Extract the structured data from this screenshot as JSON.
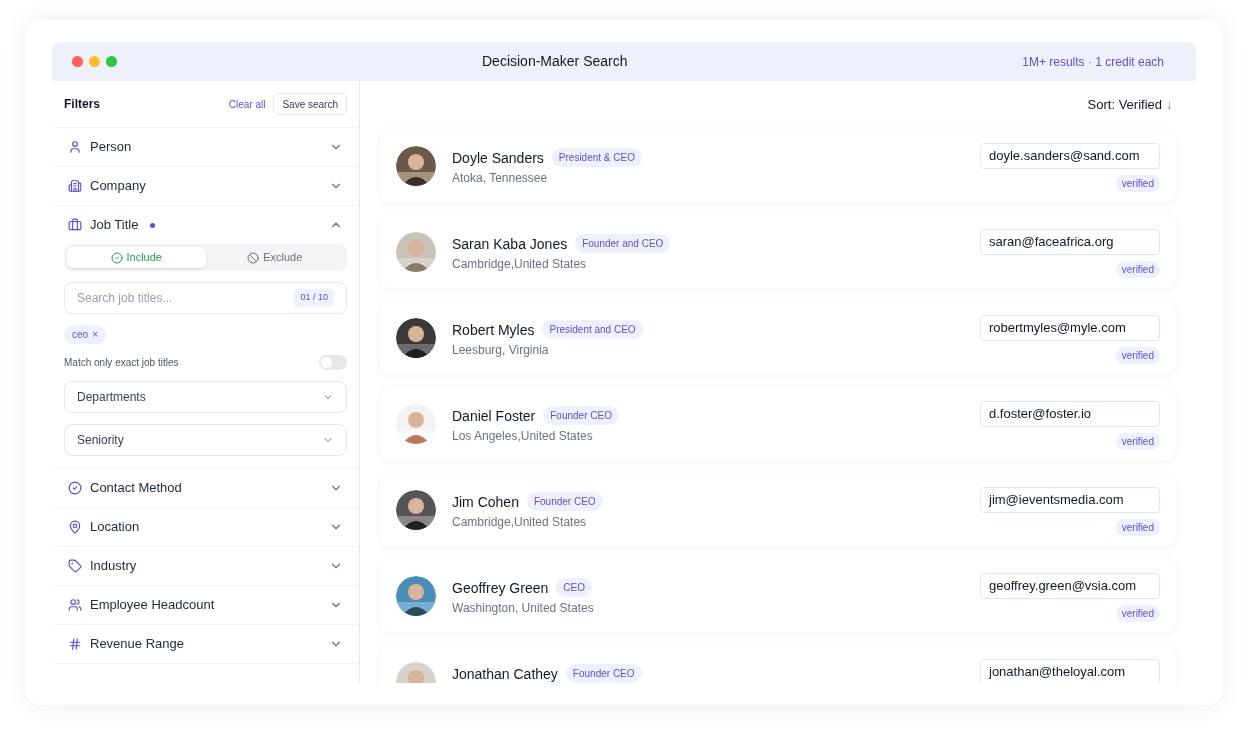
{
  "window": {
    "title": "Decision-Maker Search",
    "subtitle": "1M+ results · 1 credit each"
  },
  "filters": {
    "title": "Filters",
    "clear_label": "Clear all",
    "save_label": "Save search",
    "sections": [
      {
        "label": "Person",
        "expanded": false,
        "active": false
      },
      {
        "label": "Company",
        "expanded": false,
        "active": false
      },
      {
        "label": "Job Title",
        "expanded": true,
        "active": true
      },
      {
        "label": "Contact Method",
        "expanded": false,
        "active": false
      },
      {
        "label": "Location",
        "expanded": false,
        "active": false
      },
      {
        "label": "Industry",
        "expanded": false,
        "active": false
      },
      {
        "label": "Employee Headcount",
        "expanded": false,
        "active": false
      },
      {
        "label": "Revenue Range",
        "expanded": false,
        "active": false
      }
    ],
    "job_title": {
      "modes": [
        {
          "label": "Include",
          "selected": true
        },
        {
          "label": "Exclude",
          "selected": false
        }
      ],
      "search": {
        "placeholder": "Search job titles...",
        "counter": "01 / 10"
      },
      "chips": [
        {
          "label": "ceo",
          "remove": "×"
        }
      ],
      "exact_match": {
        "label": "Match only exact job titles",
        "on": false
      },
      "dropdowns": [
        {
          "label": "Departments"
        },
        {
          "label": "Seniority"
        }
      ]
    }
  },
  "results": {
    "sort": "Sort: Verified",
    "sort_arrow": "↓",
    "people": [
      {
        "name": "Doyle Sanders",
        "title": "President & CEO",
        "location": "Atoka, Tennessee",
        "email": "doyle.sanders@sand.com",
        "status": "verified"
      },
      {
        "name": "Saran Kaba Jones",
        "title": "Founder and CEO",
        "location": "Cambridge,United States",
        "email": "saran@faceafrica.org",
        "status": "verified"
      },
      {
        "name": "Robert Myles",
        "title": "President and CEO",
        "location": "Leesburg, Virginia",
        "email": "robertmyles@myle.com",
        "status": "verified"
      },
      {
        "name": "Daniel Foster",
        "title": "Founder CEO",
        "location": "Los Angeles,United States",
        "email": "d.foster@foster.io",
        "status": "verified"
      },
      {
        "name": "Jim Cohen",
        "title": "Founder CEO",
        "location": "Cambridge,United States",
        "email": "jim@ieventsmedia.com",
        "status": "verified"
      },
      {
        "name": "Geoffrey Green",
        "title": "CEO",
        "location": "Washington, United States",
        "email": "geoffrey.green@vsia.com",
        "status": "verified"
      },
      {
        "name": "Jonathan Cathey",
        "title": "Founder CEO",
        "email": "jonathan@theloyal.com"
      }
    ]
  }
}
